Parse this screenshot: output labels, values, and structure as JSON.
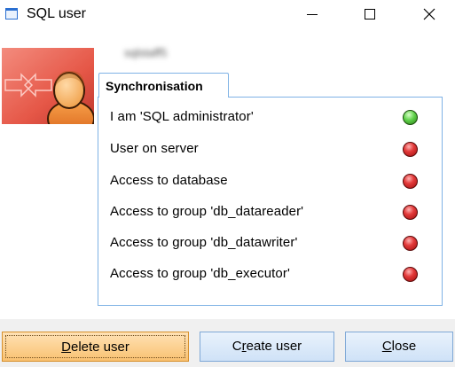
{
  "window": {
    "title": "SQL user"
  },
  "user": {
    "name": "sqlstaff5"
  },
  "tab": {
    "label": "Synchronisation"
  },
  "status_items": [
    {
      "label": "I am 'SQL administrator'",
      "status": "green"
    },
    {
      "label": "User on server",
      "status": "red"
    },
    {
      "label": "Access to database",
      "status": "red"
    },
    {
      "label": "Access to group 'db_datareader'",
      "status": "red"
    },
    {
      "label": "Access to group 'db_datawriter'",
      "status": "red"
    },
    {
      "label": "Access to group 'db_executor'",
      "status": "red"
    }
  ],
  "buttons": {
    "delete": {
      "prefix": "",
      "accel": "D",
      "rest": "elete user"
    },
    "create": {
      "prefix": "C",
      "accel": "r",
      "rest": "eate user"
    },
    "close": {
      "prefix": "",
      "accel": "C",
      "rest": "lose"
    }
  },
  "colors": {
    "accent_border": "#7fb2e5",
    "status_green": "#4cc23a",
    "status_red": "#d52a2a",
    "delete_button": "#f9c171"
  }
}
